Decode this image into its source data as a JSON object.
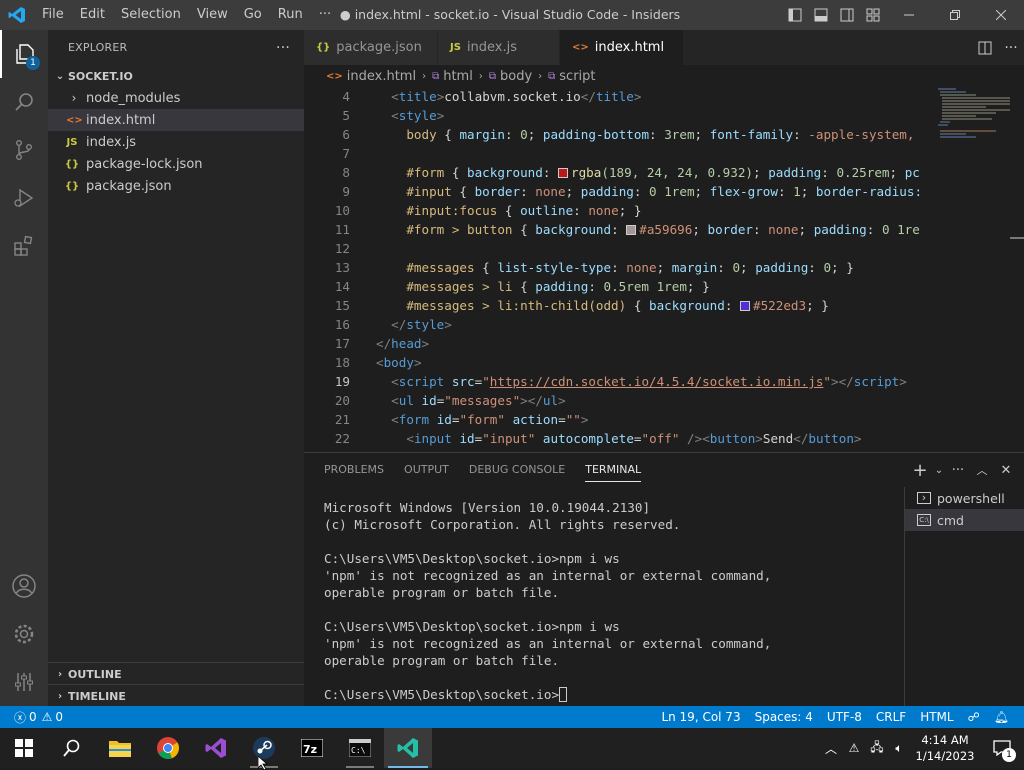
{
  "titlebar": {
    "menu": [
      "File",
      "Edit",
      "Selection",
      "View",
      "Go",
      "Run",
      "···"
    ],
    "title": "● index.html - socket.io - Visual Studio Code - Insiders"
  },
  "activity": {
    "badge": "1"
  },
  "sidebar": {
    "header": "EXPLORER",
    "header_more": "···",
    "folder": "SOCKET.IO",
    "items": [
      {
        "label": "node_modules",
        "icon": "chevron-right"
      },
      {
        "label": "index.html",
        "icon": "html-file"
      },
      {
        "label": "index.js",
        "icon": "js-file",
        "badge": "JS"
      },
      {
        "label": "package-lock.json",
        "icon": "json-file",
        "badge": "{}"
      },
      {
        "label": "package.json",
        "icon": "json-file",
        "badge": "{}"
      }
    ],
    "outline": "OUTLINE",
    "timeline": "TIMELINE"
  },
  "tabs": [
    {
      "label": "package.json",
      "icon": "{}"
    },
    {
      "label": "index.js",
      "icon": "JS"
    },
    {
      "label": "index.html",
      "icon": "<>"
    }
  ],
  "breadcrumb": [
    "index.html",
    "html",
    "body",
    "script"
  ],
  "editor": {
    "line_numbers": [
      "4",
      "5",
      "6",
      "7",
      "8",
      "9",
      "10",
      "11",
      "12",
      "13",
      "14",
      "15",
      "16",
      "17",
      "18",
      "19",
      "20",
      "21",
      "22"
    ],
    "current_line": "19",
    "l4": {
      "o": "<",
      "t": "title",
      "c": ">",
      "text": "collabvm.socket.io",
      "o2": "</",
      "t2": "title",
      "c2": ">"
    },
    "l5": {
      "o": "<",
      "t": "style",
      "c": ">"
    },
    "l6": {
      "sel": "body",
      "b": " { ",
      "p1": "margin",
      "v1": "0",
      "p2": "padding-bottom",
      "v2": "3rem",
      "p3": "font-family",
      "v3": "-apple-system,"
    },
    "l8": {
      "sel": "#form",
      "p1": "background",
      "fn": "rgba",
      "args": "(189, 24, 24, 0.932)",
      "p2": "padding",
      "v2": "0.25rem",
      "rest": "pc"
    },
    "l9": {
      "sel": "#input",
      "p1": "border",
      "v1": "none",
      "p2": "padding",
      "v2": "0 1rem",
      "p3": "flex-grow",
      "v3": "1",
      "p4": "border-radius:"
    },
    "l10": {
      "sel": "#input:focus",
      "p1": "outline",
      "v1": "none"
    },
    "l11": {
      "sel": "#form > button",
      "p1": "background",
      "v1": "#a59696",
      "p2": "border",
      "v2": "none",
      "p3": "padding",
      "v3": "0 1re"
    },
    "l13": {
      "sel": "#messages",
      "p1": "list-style-type",
      "v1": "none",
      "p2": "margin",
      "v2": "0",
      "p3": "padding",
      "v3": "0"
    },
    "l14": {
      "sel": "#messages > li",
      "p1": "padding",
      "v1": "0.5rem 1rem"
    },
    "l15": {
      "sel": "#messages > li:nth-child(odd)",
      "p1": "background",
      "v1": "#522ed3"
    },
    "l16": {
      "t": "style"
    },
    "l17": {
      "t": "head"
    },
    "l18": {
      "t": "body"
    },
    "l19": {
      "t": "script",
      "a": "src",
      "v": "https://cdn.socket.io/4.5.4/socket.io.min.js"
    },
    "l20": {
      "t": "ul",
      "a": "id",
      "v": "messages"
    },
    "l21": {
      "t": "form",
      "a": "id",
      "v": "form",
      "a2": "action",
      "v2": ""
    },
    "l22": {
      "t": "input",
      "a": "id",
      "v": "input",
      "a2": "autocomplete",
      "v2": "off",
      "t2": "button",
      "text": "Send"
    },
    "colors": {
      "rgba_swatch": "#bd1818",
      "a59696": "#a59696",
      "522ed3": "#522ed3"
    }
  },
  "panel": {
    "tabs": [
      "PROBLEMS",
      "OUTPUT",
      "DEBUG CONSOLE",
      "TERMINAL"
    ],
    "active_tab": "TERMINAL",
    "terminal_lines": [
      "Microsoft Windows [Version 10.0.19044.2130]",
      "(c) Microsoft Corporation. All rights reserved.",
      "",
      "C:\\Users\\VM5\\Desktop\\socket.io>npm i ws",
      "'npm' is not recognized as an internal or external command,",
      "operable program or batch file.",
      "",
      "C:\\Users\\VM5\\Desktop\\socket.io>npm i ws",
      "'npm' is not recognized as an internal or external command,",
      "operable program or batch file.",
      "",
      "C:\\Users\\VM5\\Desktop\\socket.io>"
    ],
    "terminals": [
      "powershell",
      "cmd"
    ]
  },
  "statusbar": {
    "errors": "0",
    "warnings": "0",
    "position": "Ln 19, Col 73",
    "spaces": "Spaces: 4",
    "encoding": "UTF-8",
    "eol": "CRLF",
    "language": "HTML"
  },
  "taskbar": {
    "time": "4:14 AM",
    "date": "1/14/2023",
    "notif": "1"
  },
  "accent": "#007acc"
}
